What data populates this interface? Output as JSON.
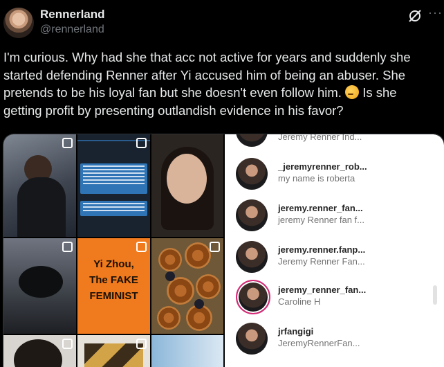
{
  "author": {
    "display_name": "Rennerland",
    "handle": "@rennerland"
  },
  "icons": {
    "grok": "grok-slash-icon",
    "more": "more-horizontal-icon",
    "emoji": "thinking-face-emoji"
  },
  "more_glyph": "···",
  "tweet": {
    "text_before_emoji": "I'm curious. Why had she that acc not active for years and suddenly she started defending Renner after Yi accused him of being an abuser. She pretends to be his loyal fan but she doesn't even follow him.",
    "text_after_emoji": " Is she getting profit by presenting outlandish evidence in his favor?"
  },
  "media": {
    "grid_card_text": "Yi Zhou, The FAKE FEMINIST",
    "grid_card_lines": [
      "Yi Zhou,",
      "The FAKE",
      "FEMINIST"
    ],
    "follow_list": [
      {
        "username": "",
        "fullname": "Jeremy Renner Ind..."
      },
      {
        "username": "_jeremyrenner_rob...",
        "fullname": "my name is roberta"
      },
      {
        "username": "jeremy.renner_fan...",
        "fullname": "jeremy Renner fan f..."
      },
      {
        "username": "jeremy.renner.fanp...",
        "fullname": "Jeremy Renner Fan..."
      },
      {
        "username": "jeremy_renner_fan...",
        "fullname": "Caroline H"
      },
      {
        "username": "jrfangigi",
        "fullname": "JeremyRennerFan..."
      }
    ]
  },
  "colors": {
    "background": "#000000",
    "text_primary": "#e7e9ea",
    "text_secondary": "#71767b",
    "orange_card": "#f07a1e",
    "story_ring": "#d62976"
  }
}
